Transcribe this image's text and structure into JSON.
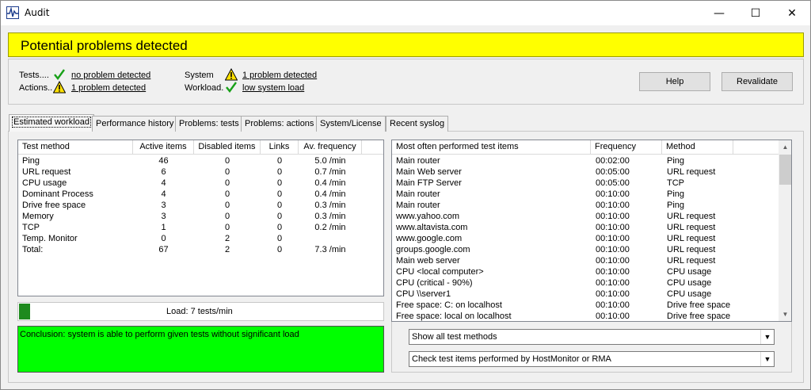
{
  "window": {
    "title": "Audit",
    "min_glyph": "—",
    "max_glyph": "☐",
    "close_glyph": "✕"
  },
  "banner": {
    "text": "Potential problems detected",
    "color": "#ffff00"
  },
  "status": {
    "tests_label": "Tests....",
    "tests_value": "no problem detected",
    "tests_icon": "checkmark-icon",
    "actions_label": "Actions..",
    "actions_value": "1 problem detected",
    "actions_icon": "warning-icon",
    "system_label": "System",
    "system_value": "1 problem detected",
    "system_icon": "warning-icon",
    "workload_label": "Workload.",
    "workload_value": "low system load",
    "workload_icon": "checkmark-icon"
  },
  "buttons": {
    "help": "Help",
    "revalidate": "Revalidate"
  },
  "tabs": [
    {
      "label": "Estimated workload",
      "active": true
    },
    {
      "label": "Performance history",
      "active": false
    },
    {
      "label": "Problems: tests",
      "active": false
    },
    {
      "label": "Problems: actions",
      "active": false
    },
    {
      "label": "System/License",
      "active": false
    },
    {
      "label": "Recent syslog",
      "active": false
    }
  ],
  "workload_table": {
    "headers": [
      "Test method",
      "Active items",
      "Disabled items",
      "Links",
      "Av. frequency"
    ],
    "rows": [
      [
        "Ping",
        "46",
        "0",
        "0",
        "5.0 /min"
      ],
      [
        "URL request",
        "6",
        "0",
        "0",
        "0.7 /min"
      ],
      [
        "CPU usage",
        "4",
        "0",
        "0",
        "0.4 /min"
      ],
      [
        "Dominant Process",
        "4",
        "0",
        "0",
        "0.4 /min"
      ],
      [
        "Drive free space",
        "3",
        "0",
        "0",
        "0.3 /min"
      ],
      [
        "Memory",
        "3",
        "0",
        "0",
        "0.3 /min"
      ],
      [
        "TCP",
        "1",
        "0",
        "0",
        "0.2 /min"
      ],
      [
        "Temp. Monitor",
        "0",
        "2",
        "0",
        ""
      ],
      [
        "Total:",
        "67",
        "2",
        "0",
        "7.3 /min"
      ]
    ]
  },
  "load": {
    "text": "Load:  7  tests/min",
    "fraction": 0.03,
    "color": "#1e8a1e"
  },
  "conclusion": {
    "text": "Conclusion: system is able to perform given tests without significant load",
    "color": "#00ff00"
  },
  "frequent_table": {
    "headers": [
      "Most often performed test items",
      "Frequency",
      "Method"
    ],
    "rows": [
      [
        "Main router",
        "00:02:00",
        "Ping"
      ],
      [
        "Main Web server",
        "00:05:00",
        "URL request"
      ],
      [
        "Main FTP Server",
        "00:05:00",
        "TCP"
      ],
      [
        "Main router",
        "00:10:00",
        "Ping"
      ],
      [
        "Main router",
        "00:10:00",
        "Ping"
      ],
      [
        "www.yahoo.com",
        "00:10:00",
        "URL request"
      ],
      [
        "www.altavista.com",
        "00:10:00",
        "URL request"
      ],
      [
        "www.google.com",
        "00:10:00",
        "URL request"
      ],
      [
        "groups.google.com",
        "00:10:00",
        "URL request"
      ],
      [
        "Main web server",
        "00:10:00",
        "URL request"
      ],
      [
        "CPU <local computer>",
        "00:10:00",
        "CPU usage"
      ],
      [
        "CPU (critical - 90%)",
        "00:10:00",
        "CPU usage"
      ],
      [
        "CPU \\\\server1",
        "00:10:00",
        "CPU usage"
      ],
      [
        "Free space: C: on localhost",
        "00:10:00",
        "Drive free space"
      ],
      [
        "Free space: local on localhost",
        "00:10:00",
        "Drive free space"
      ]
    ]
  },
  "filters": {
    "show": "Show all test methods",
    "check": "Check test items performed by HostMonitor or RMA"
  }
}
